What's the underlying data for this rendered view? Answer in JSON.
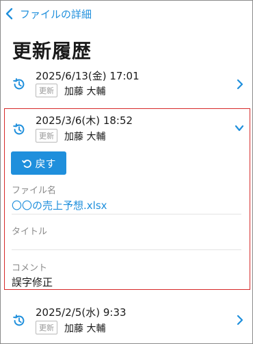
{
  "header": {
    "back_label": "ファイルの詳細"
  },
  "page": {
    "title": "更新履歴"
  },
  "history": [
    {
      "date": "2025/6/13(金) 17:01",
      "badge": "更新",
      "user": "加藤 大輔",
      "chevron": "chevron-right-icon"
    },
    {
      "date": "2025/3/6(木) 18:52",
      "badge": "更新",
      "user": "加藤 大輔",
      "chevron": "chevron-down-icon",
      "revert_label": "戻す",
      "fields": [
        {
          "label": "ファイル名",
          "value": "〇〇の売上予想.xlsx"
        },
        {
          "label": "タイトル",
          "value": ""
        },
        {
          "label": "コメント",
          "value": "誤字修正"
        }
      ]
    },
    {
      "date": "2025/2/5(水) 9:33",
      "badge": "更新",
      "user": "加藤 大輔",
      "chevron": "chevron-right-icon"
    }
  ],
  "colors": {
    "accent": "#1f8fdc",
    "selection_border": "#d62828"
  }
}
